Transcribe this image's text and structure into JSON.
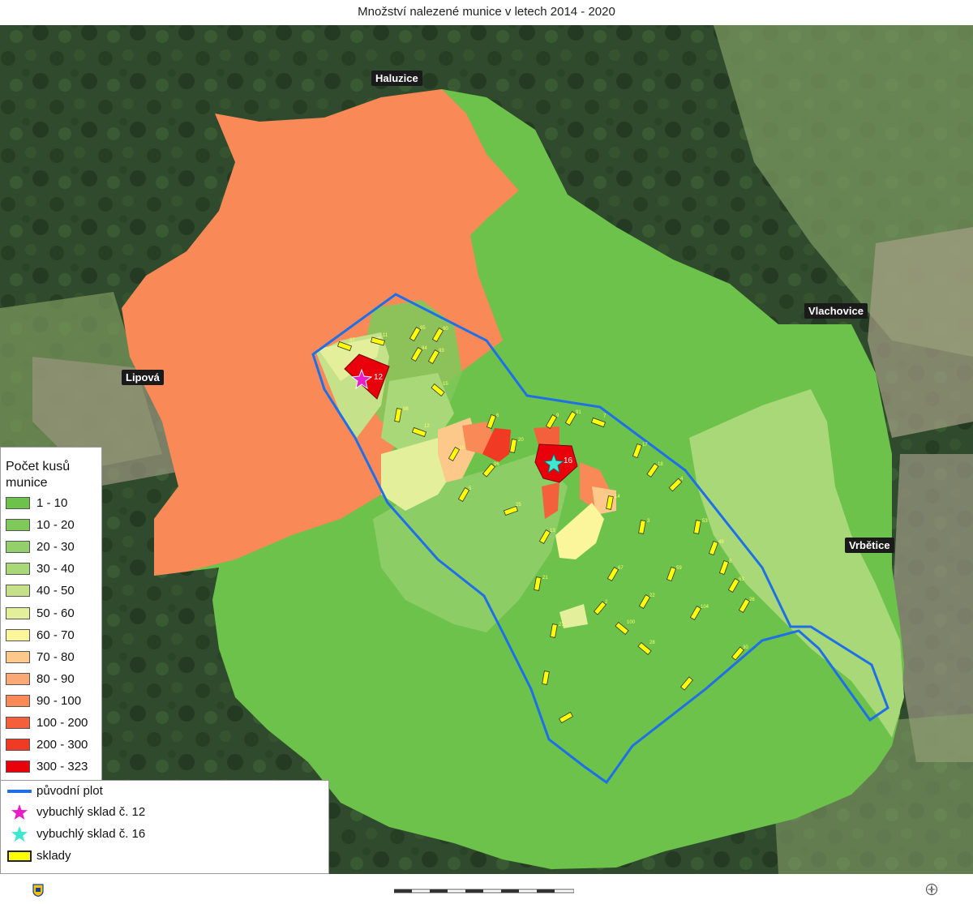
{
  "title": "Množství nalezené munice v letech  2014 - 2020",
  "places": [
    {
      "name": "Haluzice"
    },
    {
      "name": "Vlachovice"
    },
    {
      "name": "Lipová"
    },
    {
      "name": "Vrbětice"
    }
  ],
  "legend": {
    "title": "Počet kusů munice",
    "classes": [
      {
        "label": "1 - 10",
        "color": "#6cc24a"
      },
      {
        "label": "10 - 20",
        "color": "#7fc85a"
      },
      {
        "label": "20 - 30",
        "color": "#93cf6a"
      },
      {
        "label": "30 - 40",
        "color": "#a8d878"
      },
      {
        "label": "40 - 50",
        "color": "#c5e28a"
      },
      {
        "label": "50 - 60",
        "color": "#e3ef9a"
      },
      {
        "label": "60 - 70",
        "color": "#fbf59c"
      },
      {
        "label": "70 - 80",
        "color": "#fcc98a"
      },
      {
        "label": "80 - 90",
        "color": "#fba877"
      },
      {
        "label": "90 - 100",
        "color": "#f98a57"
      },
      {
        "label": "100 - 200",
        "color": "#f5603c"
      },
      {
        "label": "200 - 300",
        "color": "#f03a24"
      },
      {
        "label": "300 - 323",
        "color": "#e8000b"
      }
    ]
  },
  "legend2": {
    "fence": {
      "label": "původní plot",
      "color": "#1e6fe8"
    },
    "star12": {
      "label": "vybuchlý sklad č. 12",
      "color": "#e81ec8"
    },
    "star16": {
      "label": "vybuchlý sklad č. 16",
      "color": "#3fe7d0"
    },
    "warehouses": {
      "label": "sklady",
      "color": "#ffff00"
    }
  },
  "markers": {
    "star12_label": "12",
    "star16_label": "16"
  },
  "warehouse_labels": [
    "37",
    "11",
    "95",
    "90",
    "94",
    "93",
    "15",
    "98",
    "12",
    "6",
    "9",
    "91",
    "7",
    "16",
    "20",
    "96",
    "5",
    "25",
    "13",
    "14",
    "17",
    "18",
    "4",
    "3",
    "53",
    "49",
    "8",
    "67",
    "59",
    "21",
    "63",
    "26",
    "2",
    "22",
    "104",
    "100",
    "27",
    "28",
    "30"
  ]
}
